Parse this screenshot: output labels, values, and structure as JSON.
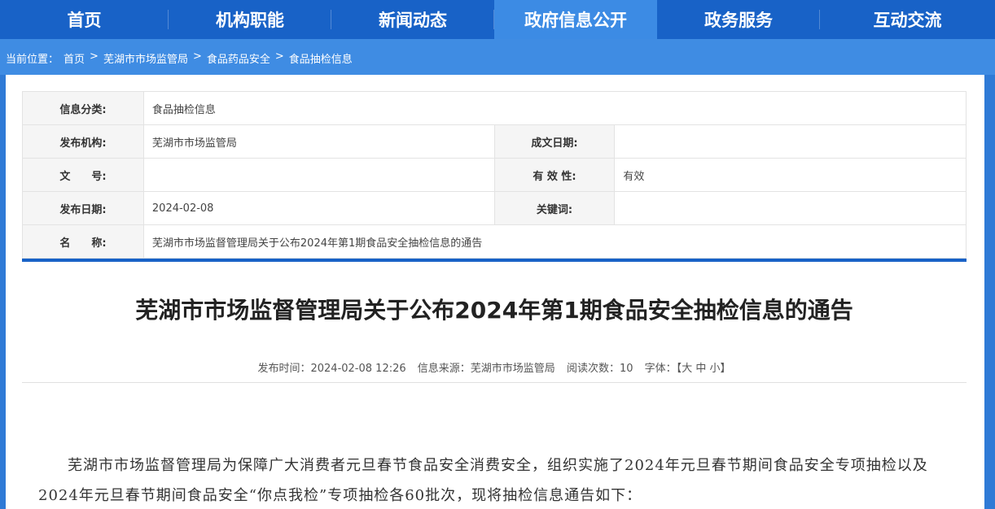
{
  "nav": {
    "items": [
      {
        "label": "首页"
      },
      {
        "label": "机构职能"
      },
      {
        "label": "新闻动态"
      },
      {
        "label": "政府信息公开"
      },
      {
        "label": "政务服务"
      },
      {
        "label": "互动交流"
      }
    ],
    "active_index": 3
  },
  "breadcrumb": {
    "prefix": "当前位置：",
    "items": [
      "首页",
      "芜湖市市场监管局",
      "食品药品安全",
      "食品抽检信息"
    ],
    "sep": ">"
  },
  "meta": {
    "category_label": "信息分类:",
    "category_value": "食品抽检信息",
    "publisher_label": "发布机构:",
    "publisher_value": "芜湖市市场监管局",
    "created_label": "成文日期:",
    "created_value": "",
    "doc_no_label": "文　　号:",
    "doc_no_value": "",
    "validity_label": "有 效 性:",
    "validity_value": "有效",
    "pub_date_label": "发布日期:",
    "pub_date_value": "2024-02-08",
    "keywords_label": "关键词:",
    "keywords_value": "",
    "name_label": "名　　称:",
    "name_value": "芜湖市市场监督管理局关于公布2024年第1期食品安全抽检信息的通告"
  },
  "article": {
    "title": "芜湖市市场监督管理局关于公布2024年第1期食品安全抽检信息的通告",
    "info": {
      "time_label": "发布时间：",
      "time_value": "2024-02-08 12:26",
      "source_label": "信息来源：",
      "source_value": "芜湖市市场监管局",
      "views_label": "阅读次数：",
      "views_value": "10",
      "font_label": "字体：",
      "font_open": "【",
      "font_large": "大",
      "font_medium": "中",
      "font_small": "小",
      "font_close": "】"
    },
    "paragraph": "芜湖市市场监督管理局为保障广大消费者元旦春节食品安全消费安全，组织实施了2024年元旦春节期间食品安全专项抽检以及 2024年元旦春节期间食品安全“你点我检”专项抽检各60批次，现将抽检信息通告如下："
  },
  "colors": {
    "nav_bg": "#1862c7",
    "nav_active": "#3c8be4",
    "page_bg": "#2f7ad6",
    "accent_rule": "#1862c7"
  }
}
